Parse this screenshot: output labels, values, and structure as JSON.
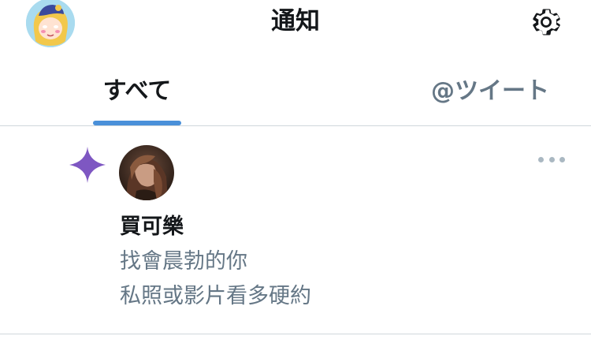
{
  "header": {
    "title": "通知",
    "avatar_icon": "user-avatar-icon",
    "settings_icon": "gear-icon"
  },
  "tabs": [
    {
      "label": "すべて",
      "active": true
    },
    {
      "label": "@ツイート",
      "active": false
    }
  ],
  "colors": {
    "accent": "#4a90d9",
    "spark": "#7e57c2",
    "text_primary": "#14171a",
    "text_secondary": "#657786"
  },
  "notifications": [
    {
      "icon": "sparkle-icon",
      "user_name": "買可樂",
      "lines": [
        "找會晨勃的你",
        "私照或影片看多硬約"
      ],
      "more_icon": "more-dots-icon"
    }
  ]
}
